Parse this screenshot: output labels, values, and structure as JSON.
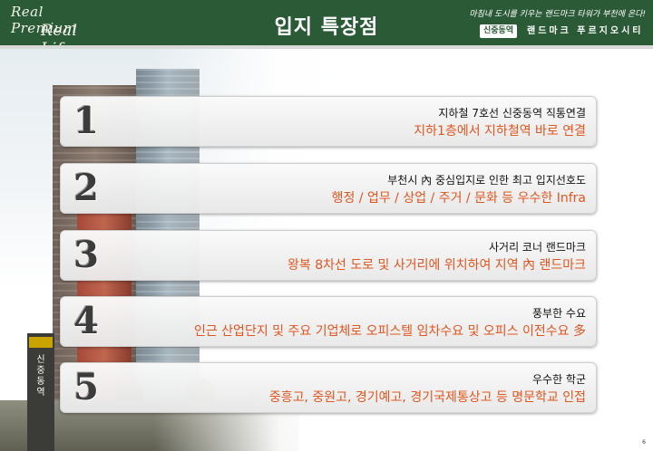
{
  "header": {
    "logo_line1": "Real Premium",
    "logo_line2": "Real Life",
    "title": "입지 특장점",
    "tagline": "마침내 도시를 키우는 랜드마크 타워가 부천에 온다!",
    "station_badge": "신중동역",
    "project_name": "랜드마크 푸르지오시티"
  },
  "photo": {
    "sign_text": "신중동역"
  },
  "rows": [
    {
      "number": "1",
      "main": "지하철 7호선 신중동역 직통연결",
      "sub": "지하1층에서 지하철역 바로 연결"
    },
    {
      "number": "2",
      "main": "부천시 內 중심입지로 인한 최고 입지선호도",
      "sub": "행정 / 업무 / 상업 / 주거 / 문화 등 우수한 Infra"
    },
    {
      "number": "3",
      "main": "사거리 코너 랜드마크",
      "sub": "왕복 8차선 도로 및 사거리에 위치하여 지역 內 랜드마크"
    },
    {
      "number": "4",
      "main": "풍부한 수요",
      "sub": "인근 산업단지 및 주요 기업체로 오피스텔 임차수요 및 오피스 이전수요 多"
    },
    {
      "number": "5",
      "main": "우수한 학군",
      "sub": "중흥고, 중원고, 경기예고, 경기국제통상고 등 명문학교 인접"
    }
  ],
  "page_number": "6",
  "colors": {
    "header_green": "#2b5a37",
    "accent_orange": "#e0561f"
  }
}
